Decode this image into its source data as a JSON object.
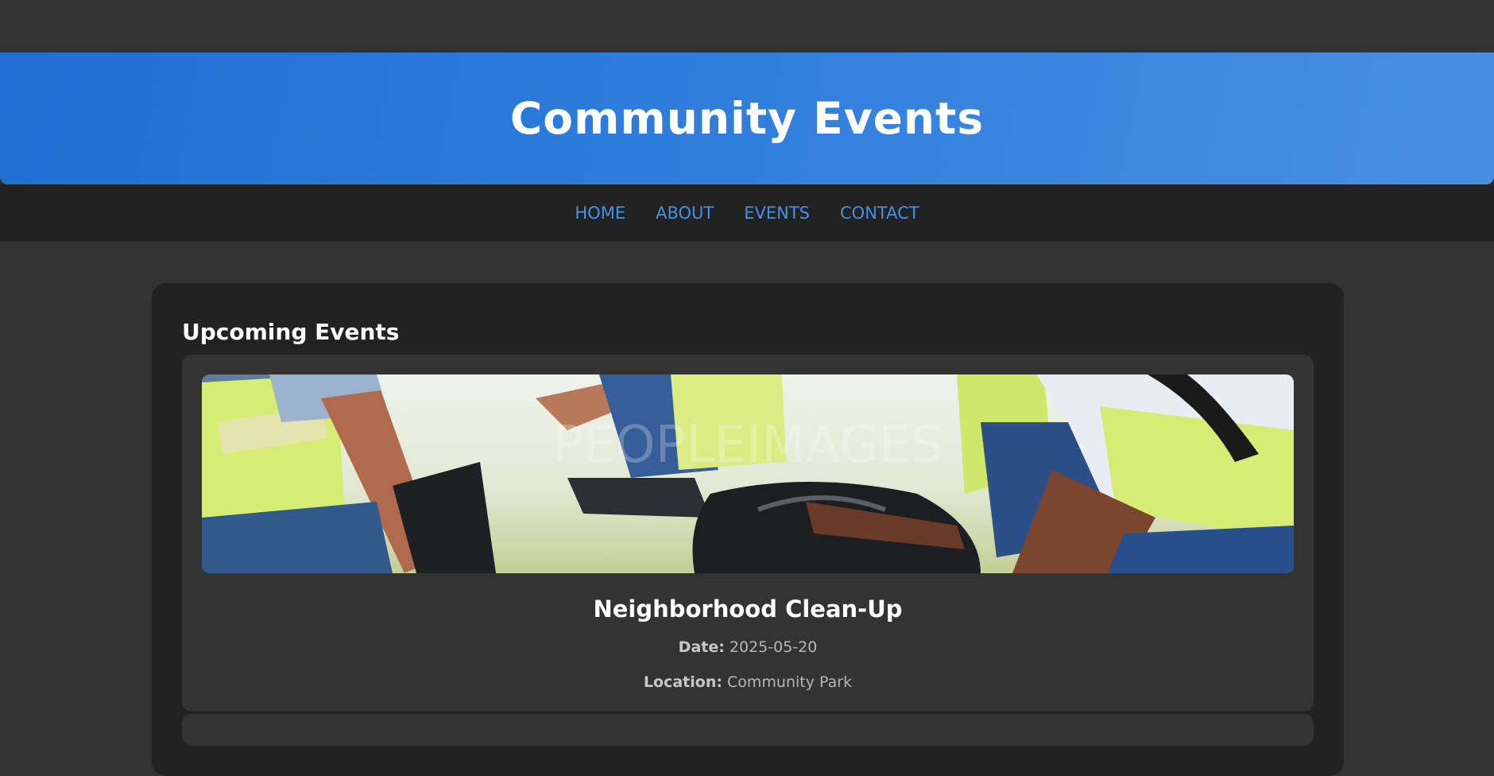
{
  "header": {
    "title": "Community Events"
  },
  "nav": {
    "items": [
      {
        "label": "HOME"
      },
      {
        "label": "ABOUT"
      },
      {
        "label": "EVENTS"
      },
      {
        "label": "CONTACT"
      }
    ]
  },
  "main": {
    "section_title": "Upcoming Events",
    "events": [
      {
        "image": "neighborhood-clean-up-photo",
        "title": "Neighborhood Clean-Up",
        "date_label": "Date:",
        "date": "2025-05-20",
        "location_label": "Location:",
        "location": "Community Park"
      }
    ]
  },
  "colors": {
    "accent": "#4a90e2",
    "banner_start": "#1f6fd4",
    "banner_end": "#4a90e2",
    "page_bg": "#333333",
    "panel_bg": "#222222"
  }
}
